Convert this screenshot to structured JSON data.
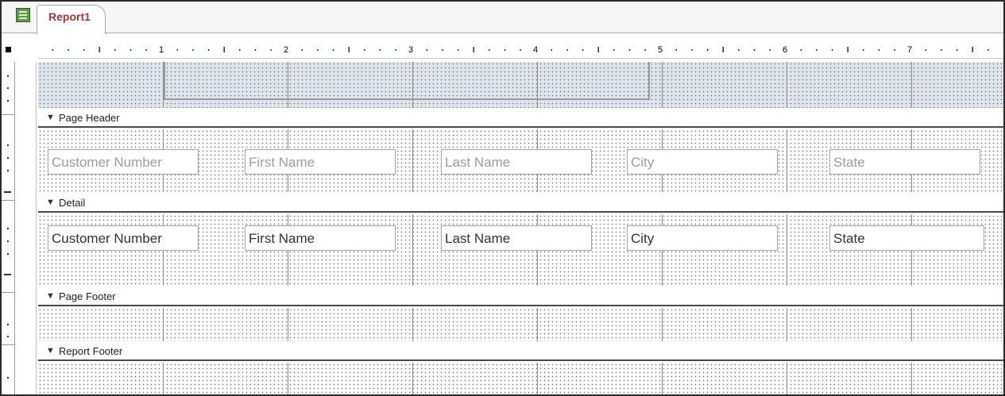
{
  "document": {
    "tab_title": "Report1",
    "tab_icon": "report-icon"
  },
  "ruler": {
    "numbers": [
      "1",
      "2",
      "3",
      "4",
      "5",
      "6",
      "7"
    ]
  },
  "sections": {
    "page_header": "Page Header",
    "detail": "Detail",
    "page_footer": "Page Footer",
    "report_footer": "Report Footer"
  },
  "page_header_labels": [
    "Customer Number",
    "First Name",
    "Last Name",
    "City",
    "State"
  ],
  "detail_fields": [
    "Customer Number",
    "First Name",
    "Last Name",
    "City",
    "State"
  ],
  "colors": {
    "tab_text": "#a4373a",
    "report_header_band": "#dfe5ee",
    "label_text": "#9c9c9c"
  }
}
